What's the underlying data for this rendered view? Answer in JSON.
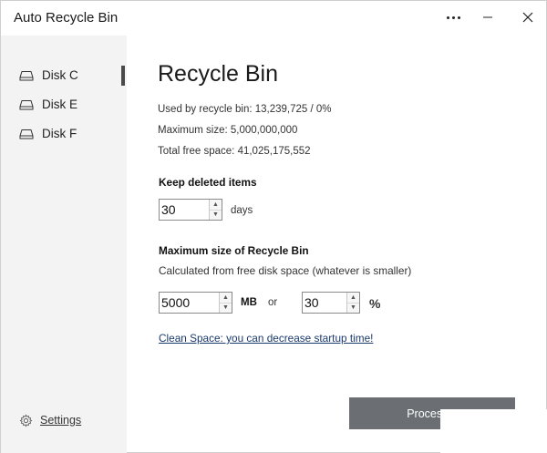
{
  "window": {
    "title": "Auto Recycle Bin"
  },
  "titlebar": {
    "more_icon": "more-dots-icon",
    "minimize_icon": "minimize-icon",
    "close_icon": "close-icon"
  },
  "sidebar": {
    "items": [
      {
        "label": "Disk C",
        "icon": "drive-icon",
        "selected": true
      },
      {
        "label": "Disk E",
        "icon": "drive-icon",
        "selected": false
      },
      {
        "label": "Disk F",
        "icon": "drive-icon",
        "selected": false
      }
    ],
    "settings_label": "Settings"
  },
  "main": {
    "title": "Recycle Bin",
    "used": "Used by recycle bin: 13,239,725 / 0%",
    "max_size": "Maximum size: 5,000,000,000",
    "free_space": "Total free space: 41,025,175,552",
    "keep_heading": "Keep deleted items",
    "keep_days_value": "30",
    "days_label": "days",
    "maxsize_heading": "Maximum size of Recycle Bin",
    "maxsize_sub": "Calculated from free disk space (whatever is smaller)",
    "mb_value": "5000",
    "mb_label": "MB",
    "or_label": "or",
    "pct_value": "30",
    "pct_label": "%",
    "clean_link": "Clean Space: you can decrease startup time!",
    "process_button": "Process..."
  },
  "colors": {
    "sidebar_bg": "#f3f3f3",
    "button_bg": "#6b6f73",
    "link": "#1a3a6b"
  }
}
